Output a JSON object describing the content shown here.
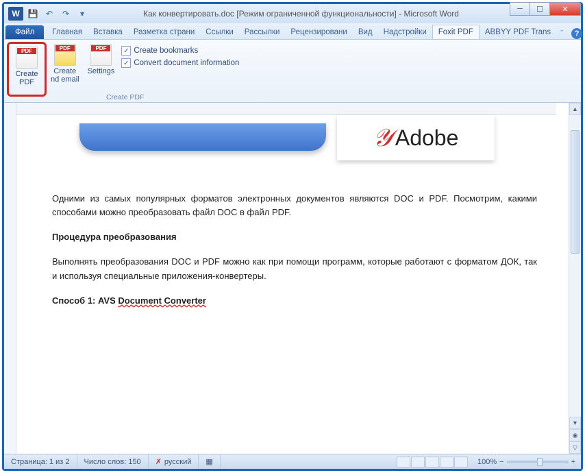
{
  "title": "Как конвертировать.doc  [Режим ограниченной функциональности]  -  Microsoft Word",
  "qat": {
    "save": "💾",
    "undo": "↶",
    "redo": "↷",
    "dropdown": "▾"
  },
  "tabs": {
    "file": "Файл",
    "items": [
      "Главная",
      "Вставка",
      "Разметка страни",
      "Ссылки",
      "Рассылки",
      "Рецензировани",
      "Вид",
      "Надстройки",
      "Foxit PDF",
      "ABBYY PDF Trans"
    ],
    "active_index": 8
  },
  "ribbon": {
    "group_label": "Create PDF",
    "create_pdf": "Create\nPDF",
    "create_email": "Create\nnd email",
    "settings": "Settings",
    "check_bookmarks": "Create bookmarks",
    "check_docinfo": "Convert document information"
  },
  "doc": {
    "adobe": "Adobe",
    "p1": "Одними из самых популярных форматов электронных документов являются DOC и PDF. Посмотрим, какими способами можно преобразовать файл DOC в файл PDF.",
    "h1": "Процедура преобразования",
    "p2": "Выполнять преобразования DOC и PDF можно как при помощи программ, которые работают с форматом ДОК, так и используя специальные приложения-конвертеры.",
    "h2_pre": "Способ 1: AVS ",
    "h2_link": "Document Converter"
  },
  "status": {
    "page": "Страница: 1 из 2",
    "words": "Число слов: 150",
    "lang": "русский",
    "zoom": "100%"
  }
}
